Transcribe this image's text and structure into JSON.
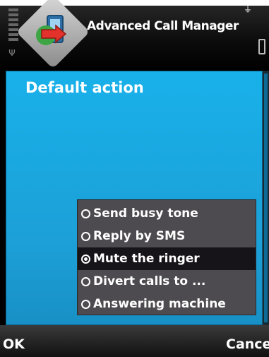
{
  "titlebar": {
    "title": "Advanced Call Manager",
    "app_icon": "advanced-call-manager-logo",
    "signal_icon": "signal-strength-icon",
    "battery_icon": "battery-icon"
  },
  "panel": {
    "title": "Default action"
  },
  "options": [
    {
      "label": "Send busy tone",
      "selected": false
    },
    {
      "label": "Reply by SMS",
      "selected": false
    },
    {
      "label": "Mute the ringer",
      "selected": true
    },
    {
      "label": "Divert calls to ...",
      "selected": false
    },
    {
      "label": "Answering machine",
      "selected": false
    }
  ],
  "softkeys": {
    "left": "OK",
    "right": "Cancel"
  },
  "colors": {
    "panel_bg": "#19b1ea",
    "list_bg": "#4d4b50",
    "list_selected_bg": "#161418"
  }
}
